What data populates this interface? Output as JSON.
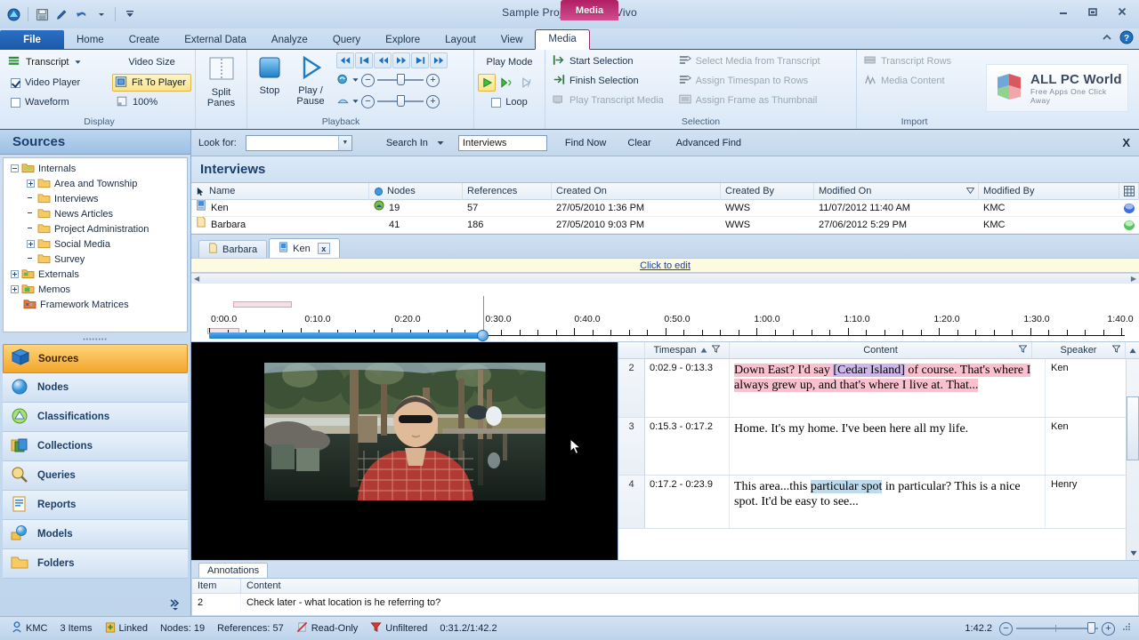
{
  "window": {
    "title": "Sample Project.nvp - NVivo",
    "minimize": "minimize",
    "maximize": "maximize",
    "close": "close"
  },
  "quick_access": [
    "nvivo-icon",
    "save-icon",
    "edit-icon",
    "undo-icon",
    "customize-icon"
  ],
  "contextual_group": {
    "label": "Media"
  },
  "ribbon_tabs": [
    {
      "label": "File",
      "key": "file"
    },
    {
      "label": "Home",
      "key": "home"
    },
    {
      "label": "Create",
      "key": "create"
    },
    {
      "label": "External Data",
      "key": "external-data"
    },
    {
      "label": "Analyze",
      "key": "analyze"
    },
    {
      "label": "Query",
      "key": "query"
    },
    {
      "label": "Explore",
      "key": "explore"
    },
    {
      "label": "Layout",
      "key": "layout"
    },
    {
      "label": "View",
      "key": "view"
    },
    {
      "label": "Media",
      "key": "media"
    }
  ],
  "ribbon": {
    "display": {
      "group_label": "Display",
      "transcript": "Transcript",
      "video_player": "Video Player",
      "waveform": "Waveform",
      "video_size_label": "Video Size",
      "fit_to_player": "Fit To Player",
      "zoom_100": "100%",
      "video_player_checked": true,
      "waveform_checked": false
    },
    "split": {
      "line1": "Split",
      "line2": "Panes"
    },
    "playback": {
      "group_label": "Playback",
      "stop": "Stop",
      "play_pause_line1": "Play /",
      "play_pause_line2": "Pause",
      "play_mode_label": "Play Mode",
      "loop": "Loop",
      "loop_checked": false
    },
    "selection": {
      "group_label": "Selection",
      "items": [
        "Start Selection",
        "Finish Selection",
        "Play Transcript Media",
        "Select Media from Transcript",
        "Assign Timespan to Rows",
        "Assign Frame as Thumbnail"
      ]
    },
    "import": {
      "group_label": "Import",
      "items": [
        "Transcript Rows",
        "Media Content"
      ]
    }
  },
  "logo": {
    "title": "ALL PC World",
    "tagline": "Free Apps One Click Away"
  },
  "sidebar": {
    "header": "Sources",
    "tree": [
      {
        "label": "Internals",
        "depth": 0,
        "expander": "minus",
        "icon": "folder-internals-icon"
      },
      {
        "label": "Area and Township",
        "depth": 1,
        "expander": "plus",
        "icon": "folder-icon"
      },
      {
        "label": "Interviews",
        "depth": 1,
        "expander": "none",
        "icon": "folder-icon"
      },
      {
        "label": "News Articles",
        "depth": 1,
        "expander": "none",
        "icon": "folder-icon"
      },
      {
        "label": "Project Administration",
        "depth": 1,
        "expander": "none",
        "icon": "folder-icon"
      },
      {
        "label": "Social Media",
        "depth": 1,
        "expander": "plus",
        "icon": "folder-icon"
      },
      {
        "label": "Survey",
        "depth": 1,
        "expander": "none",
        "icon": "folder-icon"
      },
      {
        "label": "Externals",
        "depth": 0,
        "expander": "plus",
        "icon": "folder-externals-icon"
      },
      {
        "label": "Memos",
        "depth": 0,
        "expander": "plus",
        "icon": "folder-memos-icon"
      },
      {
        "label": "Framework Matrices",
        "depth": 0,
        "expander": "none",
        "icon": "framework-matrices-icon"
      }
    ],
    "nav_items": [
      {
        "label": "Sources",
        "icon": "sources-icon",
        "selected": true
      },
      {
        "label": "Nodes",
        "icon": "nodes-icon",
        "selected": false
      },
      {
        "label": "Classifications",
        "icon": "classifications-icon",
        "selected": false
      },
      {
        "label": "Collections",
        "icon": "collections-icon",
        "selected": false
      },
      {
        "label": "Queries",
        "icon": "queries-icon",
        "selected": false
      },
      {
        "label": "Reports",
        "icon": "reports-icon",
        "selected": false
      },
      {
        "label": "Models",
        "icon": "models-icon",
        "selected": false
      },
      {
        "label": "Folders",
        "icon": "folders-icon",
        "selected": false
      }
    ]
  },
  "findbar": {
    "look_for_label": "Look for:",
    "look_for_value": "",
    "search_in_label": "Search In",
    "scope_value": "Interviews",
    "find_now": "Find Now",
    "clear": "Clear",
    "advanced_find": "Advanced Find",
    "close": "X"
  },
  "list_view": {
    "title": "Interviews",
    "columns": [
      "Name",
      "Nodes",
      "References",
      "Created On",
      "Created By",
      "Modified On",
      "Modified By"
    ],
    "rows": [
      {
        "name": "Ken",
        "nodes": "19",
        "references": "57",
        "created_on": "27/05/2010 1:36 PM",
        "created_by": "WWS",
        "modified_on": "11/07/2012 11:40 AM",
        "modified_by": "KMC",
        "icon": "video-source-icon",
        "dot": "blue"
      },
      {
        "name": "Barbara",
        "nodes": "41",
        "references": "186",
        "created_on": "27/05/2010 9:03 PM",
        "created_by": "WWS",
        "modified_on": "27/06/2012 5:29 PM",
        "modified_by": "KMC",
        "icon": "document-source-icon",
        "dot": "green"
      }
    ]
  },
  "doc_tabs": [
    {
      "label": "Barbara",
      "active": false,
      "icon": "document-icon"
    },
    {
      "label": "Ken",
      "active": true,
      "icon": "video-icon",
      "close": "x"
    }
  ],
  "edit_bar": {
    "link": "Click to edit"
  },
  "timeline": {
    "tick_labels": [
      "0:00.0",
      "0:10.0",
      "0:20.0",
      "0:30.0",
      "0:40.0",
      "0:50.0",
      "1:00.0",
      "1:10.0",
      "1:20.0",
      "1:30.0",
      "1:40.0"
    ],
    "position": "0:31.2",
    "duration": "1:42.2",
    "annotation_bars": 2
  },
  "transcript": {
    "columns": [
      "Timespan",
      "Content",
      "Speaker"
    ],
    "rows": [
      {
        "num": "2",
        "timespan": "0:02.9 - 0:13.3",
        "speaker": "Ken",
        "segments": [
          {
            "text": "Down East? I'd say ",
            "hl": "pink"
          },
          {
            "text": "[Cedar Island]",
            "hl": "purple"
          },
          {
            "text": " of course. That's where I always grew up, and that's where I live at. That...",
            "hl": "pink"
          }
        ]
      },
      {
        "num": "3",
        "timespan": "0:15.3 - 0:17.2",
        "speaker": "Ken",
        "segments": [
          {
            "text": "Home. It's my home. I've been here all my life.",
            "hl": "none"
          }
        ]
      },
      {
        "num": "4",
        "timespan": "0:17.2 - 0:23.9",
        "speaker": "Henry",
        "segments": [
          {
            "text": "This area...this ",
            "hl": "none"
          },
          {
            "text": "particular spot",
            "hl": "blue"
          },
          {
            "text": " in particular? This is a nice spot. It'd be easy to see...",
            "hl": "none"
          }
        ]
      }
    ]
  },
  "annotations": {
    "tab_label": "Annotations",
    "columns": [
      "Item",
      "Content"
    ],
    "rows": [
      {
        "item": "2",
        "content": "Check later - what location is he referring to?"
      }
    ]
  },
  "statusbar": {
    "user": "KMC",
    "items_count": "3 Items",
    "linked": "Linked",
    "nodes": "Nodes: 19",
    "references": "References: 57",
    "read_only": "Read-Only",
    "unfiltered": "Unfiltered",
    "time": "0:31.2/1:42.2",
    "duration": "1:42.2"
  },
  "colors": {
    "accent_blue": "#1d59a8",
    "contextual_magenta": "#b01e63",
    "selection_orange": "#f2a62b",
    "highlight_pink": "#f9c0cf",
    "highlight_purple": "#cdb7e8",
    "highlight_blue": "#bcdcee"
  }
}
